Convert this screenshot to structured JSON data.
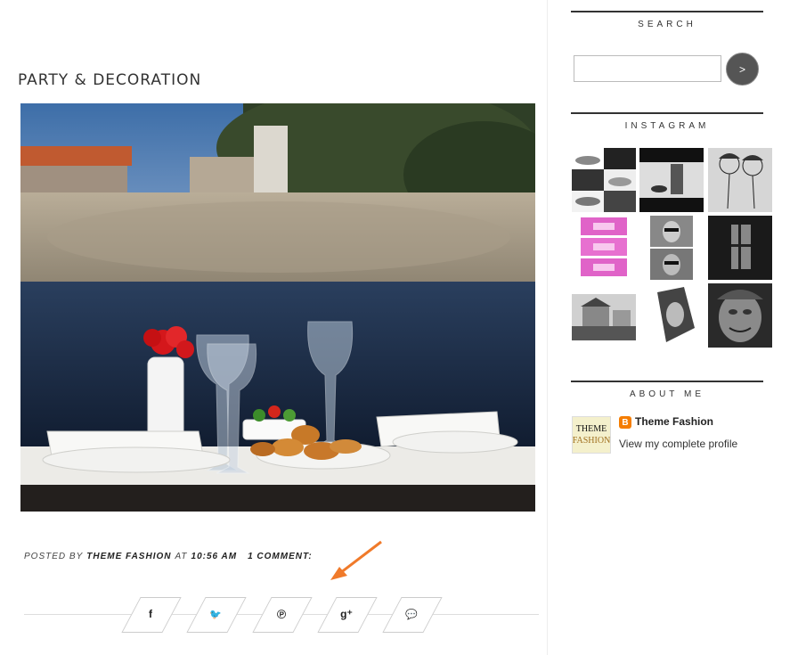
{
  "post": {
    "title": "PARTY & DECORATION",
    "footer": {
      "posted_by_label": "Posted by",
      "author": "Theme Fashion",
      "at_label": "at",
      "time": "10:56 AM",
      "comments": "1 comment:"
    },
    "share_buttons": [
      {
        "glyph": "f",
        "icon": "facebook-icon"
      },
      {
        "glyph": "🐦",
        "icon": "twitter-icon"
      },
      {
        "glyph": "℗",
        "icon": "pinterest-icon"
      },
      {
        "glyph": "g⁺",
        "icon": "google-plus-icon"
      },
      {
        "glyph": "💬",
        "icon": "comment-icon"
      }
    ]
  },
  "sidebar": {
    "search": {
      "title": "SEARCH",
      "placeholder": "",
      "button_label": ">"
    },
    "instagram": {
      "title": "INSTAGRAM"
    },
    "about": {
      "title": "ABOUT ME",
      "thumb_line1": "THEME",
      "thumb_line2": "FASHION",
      "name": "Theme Fashion",
      "link": "View my complete profile"
    }
  },
  "colors": {
    "arrow": "#f07a2a",
    "accent_dark": "#555555",
    "blogger": "#f57d00"
  }
}
